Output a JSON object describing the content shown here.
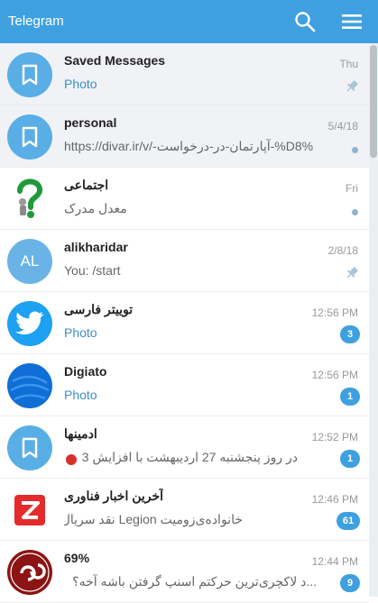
{
  "app": {
    "title": "Telegram"
  },
  "colors": {
    "header": "#3fa0e0",
    "accent": "#3fa0e0"
  },
  "chats": [
    {
      "name": "Saved Messages",
      "date": "Thu",
      "preview": "Photo",
      "status": "pinned",
      "avatar": "bookmark-icon"
    },
    {
      "name": "personal",
      "date": "5/4/18",
      "preview": "https://divar.ir/v/-آپارتمان-در-درخواست-%D8%",
      "status": "unread-dot",
      "avatar": "bookmark-icon"
    },
    {
      "name": "اجتماعی",
      "date": "Fri",
      "preview": "معدل مدرک",
      "status": "unread-dot",
      "avatar": "question-person-icon"
    },
    {
      "name": "alikharidar",
      "date": "2/8/18",
      "preview": "You: /start",
      "status": "pinned",
      "avatar_initials": "AL"
    },
    {
      "name": "تویيتر فارسی",
      "date": "12:56 PM",
      "preview": "Photo",
      "badge": "3",
      "avatar": "twitter-bird-icon"
    },
    {
      "name": "Digiato",
      "date": "12:56 PM",
      "preview": "Photo",
      "badge": "1",
      "avatar": "digiato-logo-icon"
    },
    {
      "name": "ادمينها",
      "date": "12:52 PM",
      "preview": "در روز پنجشنبه 27 ارديبهشت با افزايش 3",
      "badge": "1",
      "avatar": "bookmark-icon"
    },
    {
      "name": "آخرين اخبار فناوری",
      "date": "12:46 PM",
      "preview": "خانواده‌ی‌زوميت Legion نقد سريال",
      "badge": "61",
      "avatar": "zoomit-logo-icon"
    },
    {
      "name": "69%",
      "date": "12:44 PM",
      "preview": "...د لاکچری‌ترين حرکتم اسنپ گرفتن باشه آخه؟",
      "badge": "9",
      "avatar": "channel-logo-icon"
    }
  ]
}
